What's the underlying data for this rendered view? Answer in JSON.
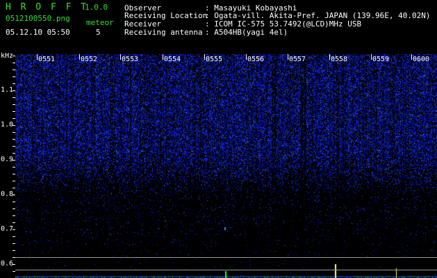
{
  "header": {
    "app_name": "H R O F F T",
    "version": "1.0.0",
    "filename": "0512100550.png",
    "meteor_label": "meteor",
    "meteor_count": "5",
    "datetime": "05.12.10 05:50",
    "fields": [
      {
        "label": "Observer",
        "value": ": Masayuki Kobayashi"
      },
      {
        "label": "Receiving Location",
        "value": ": Ogata-vill. Akita-Pref. JAPAN (139.96E, 40.02N)"
      },
      {
        "label": "Receiver",
        "value": ": ICOM IC-575 53.7492(@LCD)MHz USB"
      },
      {
        "label": "Receiving antenna",
        "value": ": A504HB(yagi 4el)"
      }
    ]
  },
  "axis": {
    "unit": "kHz",
    "y_labels": [
      "1.1",
      "1.0",
      "0.9",
      "0.8",
      "0.7",
      "0.6"
    ],
    "time_labels": [
      "0551",
      "0552",
      "0553",
      "0554",
      "0555",
      "0556",
      "0557",
      "0558",
      "0559",
      "0600"
    ]
  },
  "colors": {
    "noise": "#2b3cff",
    "meteor": "#3a8cff",
    "header_green": "#33e033",
    "signal_green": "#22ff22",
    "signal_yellow": "#ffff66"
  }
}
